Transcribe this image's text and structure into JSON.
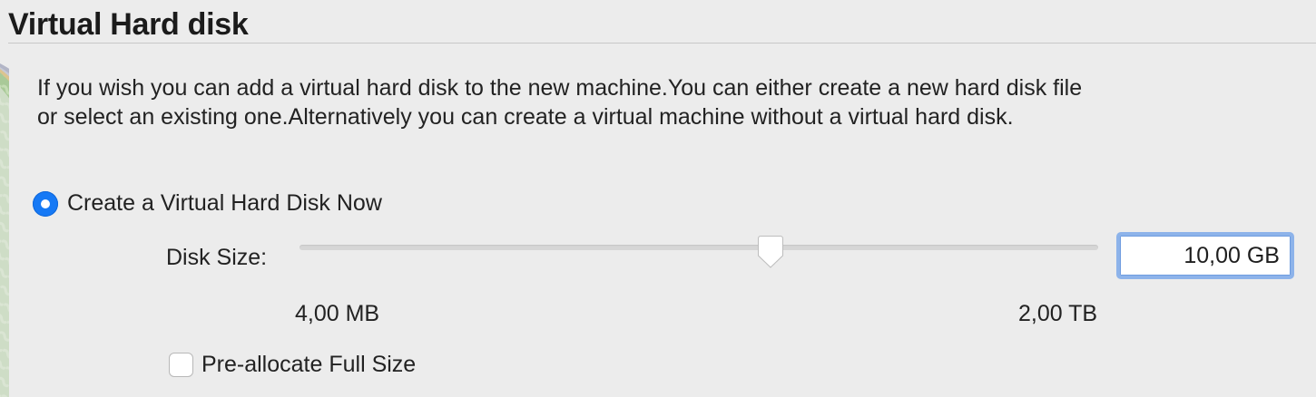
{
  "page": {
    "title": "Virtual Hard disk",
    "description": "If you wish you can add a virtual hard disk to the new machine.You can either create a new hard disk file or select an existing one.Alternatively you can create a virtual machine without a virtual hard disk."
  },
  "options": {
    "create_now": {
      "label": "Create a Virtual Hard Disk Now",
      "selected": true
    }
  },
  "disk_size": {
    "label": "Disk Size:",
    "value": "10,00 GB",
    "min_label": "4,00 MB",
    "max_label": "2,00 TB",
    "slider_fraction": 0.59
  },
  "preallocate": {
    "label": "Pre-allocate Full Size",
    "checked": false
  },
  "colors": {
    "accent": "#1679f5",
    "background": "#ececec",
    "focus_ring": "#8db3ea"
  },
  "icons": {
    "decoration": "disk-watermark-icon",
    "slider": "slider-thumb-icon"
  }
}
